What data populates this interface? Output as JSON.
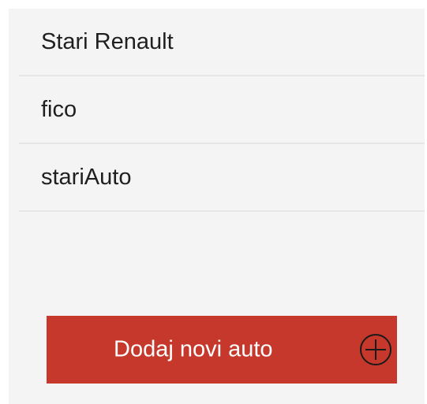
{
  "cars": [
    {
      "name": "Stari Renault"
    },
    {
      "name": "fico"
    },
    {
      "name": "stariAuto"
    }
  ],
  "add_button": {
    "label": "Dodaj novi auto",
    "icon": "plus-circle-icon"
  },
  "colors": {
    "background": "#f4f4f4",
    "divider": "#e6e6e6",
    "accent": "#c5382b",
    "text": "#1f1f1f"
  }
}
